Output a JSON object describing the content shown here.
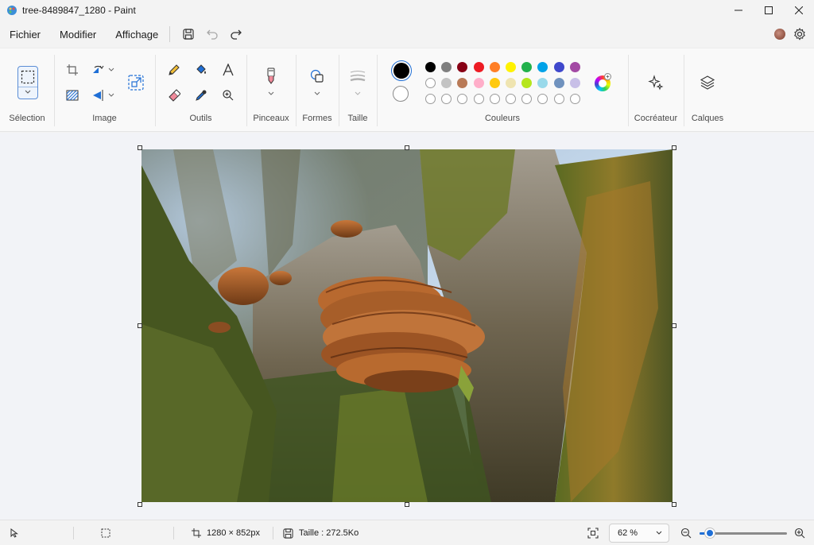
{
  "window": {
    "title": "tree-8489847_1280 - Paint"
  },
  "menu": {
    "file": "Fichier",
    "edit": "Modifier",
    "view": "Affichage"
  },
  "ribbon": {
    "selection_label": "Sélection",
    "image_label": "Image",
    "tools_label": "Outils",
    "brushes_label": "Pinceaux",
    "shapes_label": "Formes",
    "size_label": "Taille",
    "colors_label": "Couleurs",
    "cocreator_label": "Cocréateur",
    "layers_label": "Calques"
  },
  "colors": {
    "primary": "#000000",
    "secondary": "#ffffff",
    "palette_row1": [
      "#000000",
      "#7f7f7f",
      "#880015",
      "#ed1c24",
      "#ff7f27",
      "#fff200",
      "#22b14c",
      "#00a2e8",
      "#3f48cc",
      "#a349a4"
    ],
    "palette_row2": [
      "#ffffff",
      "#c3c3c3",
      "#b97a57",
      "#ffaec9",
      "#ffc90e",
      "#efe4b0",
      "#b5e61d",
      "#99d9ea",
      "#7092be",
      "#c8bfe7"
    ]
  },
  "status": {
    "dimensions": "1280 × 852px",
    "file_size": "Taille : 272.5Ko",
    "zoom": "62 %",
    "zoom_level": 0.62
  }
}
